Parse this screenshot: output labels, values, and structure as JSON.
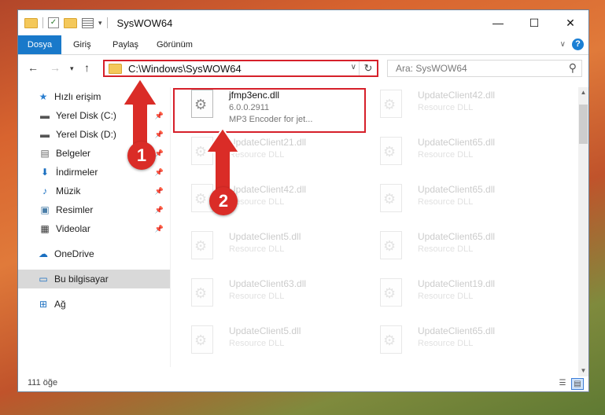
{
  "title_bar": {
    "title": "SysWOW64",
    "controls": {
      "minimize": "—",
      "maximize": "☐",
      "close": "✕"
    }
  },
  "ribbon": {
    "file_tab": "Dosya",
    "tabs": [
      "Giriş",
      "Paylaş",
      "Görünüm"
    ],
    "help_label": "?"
  },
  "nav_bar": {
    "address": "C:\\Windows\\SysWOW64",
    "search_placeholder": "Ara: SysWOW64"
  },
  "sidebar": {
    "quick_access": "Hızlı erişim",
    "pinned": [
      "Yerel Disk (C:)",
      "Yerel Disk (D:)",
      "Belgeler",
      "İndirmeler",
      "Müzik",
      "Resimler",
      "Videolar"
    ],
    "onedrive": "OneDrive",
    "this_pc": "Bu bilgisayar",
    "network": "Ağ"
  },
  "files": [
    {
      "name": "jfmp3enc.dll",
      "line1": "6.0.0.2911",
      "line2": "MP3 Encoder for jet...",
      "highlighted": true
    },
    {
      "name": "UpdateClient42.dll",
      "line1": "Resource DLL",
      "line2": ""
    },
    {
      "name": "UpdateClient21.dll",
      "line1": "Resource DLL",
      "line2": ""
    },
    {
      "name": "UpdateClient65.dll",
      "line1": "Resource DLL",
      "line2": ""
    },
    {
      "name": "UpdateClient42.dll",
      "line1": "Resource DLL",
      "line2": ""
    },
    {
      "name": "UpdateClient65.dll",
      "line1": "Resource DLL",
      "line2": ""
    },
    {
      "name": "UpdateClient5.dll",
      "line1": "Resource DLL",
      "line2": ""
    },
    {
      "name": "UpdateClient65.dll",
      "line1": "Resource DLL",
      "line2": ""
    },
    {
      "name": "UpdateClient63.dll",
      "line1": "Resource DLL",
      "line2": ""
    },
    {
      "name": "UpdateClient19.dll",
      "line1": "Resource DLL",
      "line2": ""
    },
    {
      "name": "UpdateClient5.dll",
      "line1": "Resource DLL",
      "line2": ""
    },
    {
      "name": "UpdateClient65.dll",
      "line1": "Resource DLL",
      "line2": ""
    }
  ],
  "status_bar": {
    "item_count": "111 öğe"
  },
  "annotations": {
    "step1": "1",
    "step2": "2"
  },
  "colors": {
    "accent": "#1979ca",
    "highlight": "#d6202a",
    "marker": "#da2c27"
  }
}
